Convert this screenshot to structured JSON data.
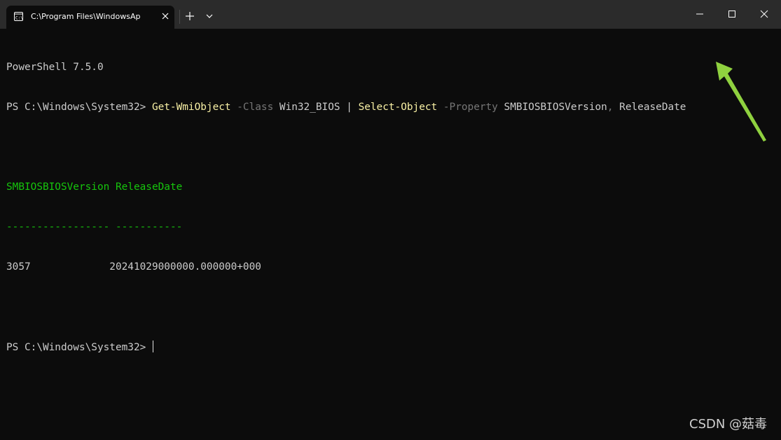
{
  "tab": {
    "title": "C:\\Program Files\\WindowsAp"
  },
  "terminal": {
    "banner": "PowerShell 7.5.0",
    "prompt": "PS C:\\Windows\\System32> ",
    "command": {
      "cmdlet1": "Get-WmiObject",
      "param1": "-Class",
      "arg1": "Win32_BIOS",
      "pipe": "|",
      "cmdlet2": "Select-Object",
      "param2": "-Property",
      "arg2": "SMBIOSBIOSVersion",
      "comma": ",",
      "arg3": "ReleaseDate"
    },
    "table": {
      "headers": [
        "SMBIOSBIOSVersion",
        "ReleaseDate"
      ],
      "separators": [
        "-----------------",
        "-----------"
      ],
      "rows": [
        [
          "3057",
          "20241029000000.000000+000"
        ]
      ]
    },
    "prompt2": "PS C:\\Windows\\System32> "
  },
  "annotation": {
    "arrow_color": "#8fd13f"
  },
  "watermark": "CSDN @菇毒",
  "colors": {
    "background": "#0c0c0c",
    "titlebar": "#2b2b2b",
    "cmdlet": "#f9f1a5",
    "parameter": "#767676",
    "header": "#16c60c",
    "text": "#cccccc"
  }
}
